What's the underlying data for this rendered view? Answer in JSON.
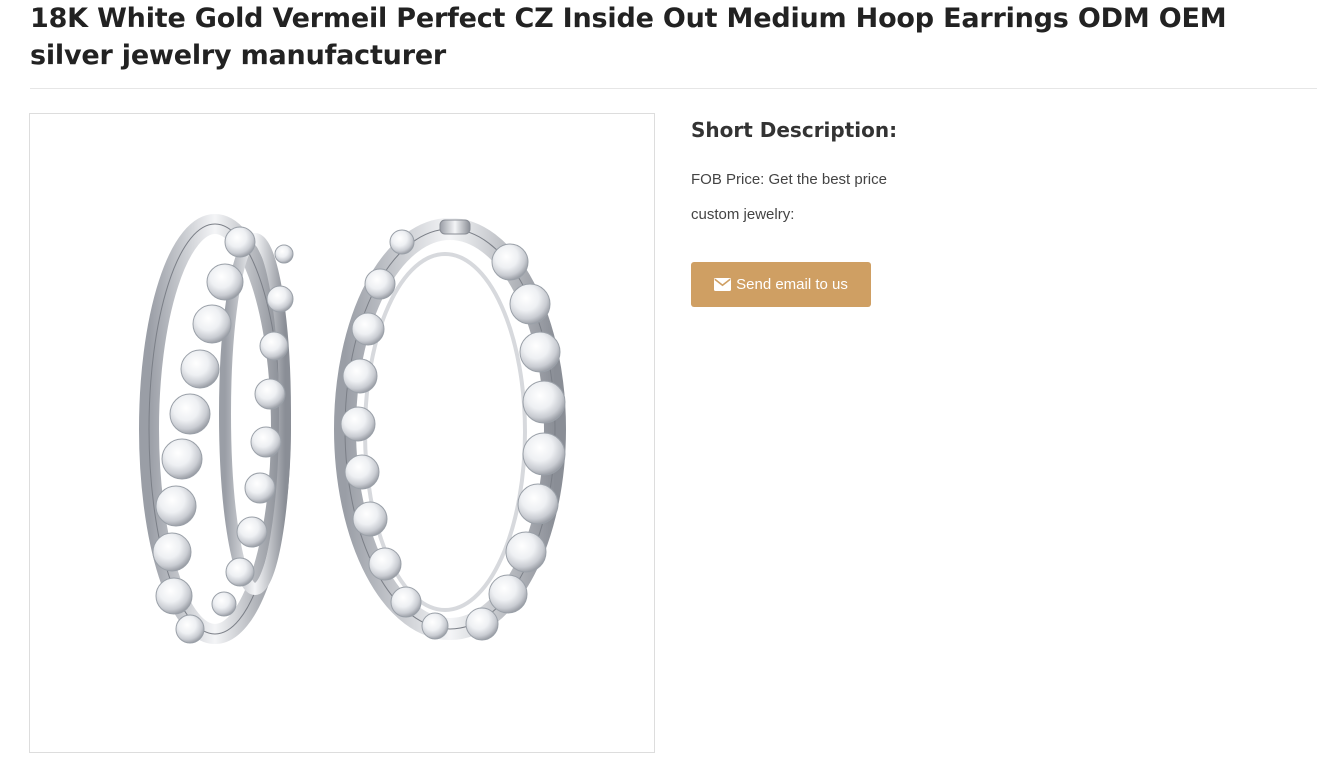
{
  "product": {
    "title": "18K White Gold Vermeil Perfect CZ Inside Out Medium Hoop Earrings ODM OEM silver jewelry manufacturer",
    "image_alt": "silver hoop earrings with clear stones"
  },
  "description": {
    "heading": "Short Description:",
    "fob_price": "FOB Price: Get the best price",
    "custom_jewelry": "custom jewelry:"
  },
  "actions": {
    "send_email_label": "Send email to us",
    "send_email_icon": "envelope-icon"
  },
  "colors": {
    "button_bg": "#cf9f63",
    "title_text": "#222222",
    "divider": "#e6e6e6"
  }
}
